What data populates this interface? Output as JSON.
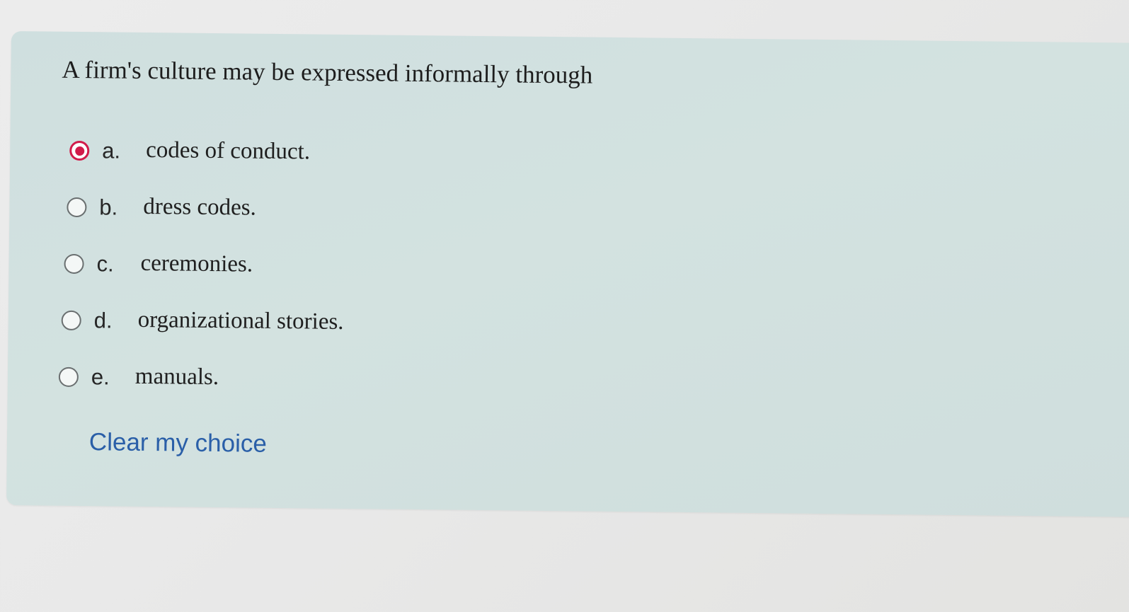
{
  "question": {
    "text": "A firm's culture may be expressed informally through"
  },
  "options": [
    {
      "letter": "a.",
      "text": "codes of conduct.",
      "selected": true
    },
    {
      "letter": "b.",
      "text": "dress codes.",
      "selected": false
    },
    {
      "letter": "c.",
      "text": "ceremonies.",
      "selected": false
    },
    {
      "letter": "d.",
      "text": "organizational stories.",
      "selected": false
    },
    {
      "letter": "e.",
      "text": "manuals.",
      "selected": false
    }
  ],
  "clear_choice_label": "Clear my choice",
  "colors": {
    "selected_radio": "#d11b4a",
    "link": "#2a5fa8",
    "panel_background": "#d1e0df"
  }
}
